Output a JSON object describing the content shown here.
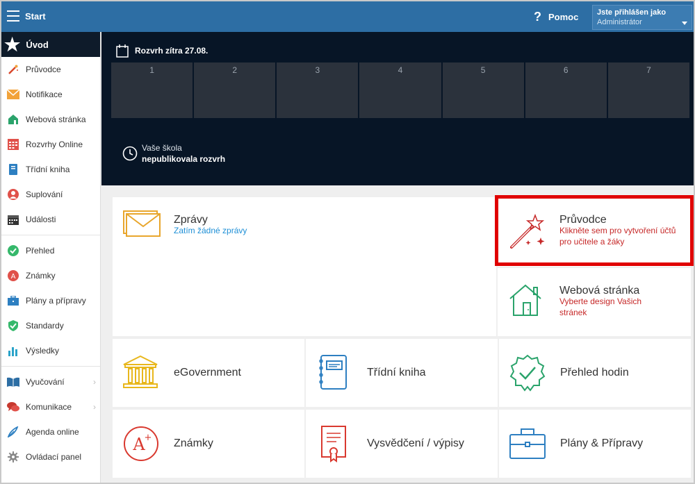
{
  "topbar": {
    "title": "Start",
    "help_label": "Pomoc",
    "user_line1": "Jste přihlášen jako",
    "user_line2": "Administrátor"
  },
  "sidebar": {
    "active": "Úvod",
    "group1": [
      "Průvodce",
      "Notifikace",
      "Webová stránka",
      "Rozvrhy Online",
      "Třídní kniha",
      "Suplování",
      "Události"
    ],
    "group2": [
      "Přehled",
      "Známky",
      "Plány a přípravy",
      "Standardy",
      "Výsledky"
    ],
    "group3": [
      "Vyučování",
      "Komunikace",
      "Agenda online",
      "Ovládací panel"
    ]
  },
  "schedule": {
    "title": "Rozvrh zítra 27.08.",
    "periods": [
      "1",
      "2",
      "3",
      "4",
      "5",
      "6",
      "7"
    ],
    "school_line1": "Vaše škola",
    "school_line2": "nepublikovala rozvrh"
  },
  "tiles": {
    "messages": {
      "title": "Zprávy",
      "subtitle": "Zatím žádné zprávy"
    },
    "wizard": {
      "title": "Průvodce",
      "subtitle": "Klikněte sem pro vytvoření účtů pro učitele a žáky"
    },
    "website": {
      "title": "Webová stránka",
      "subtitle": "Vyberte design Vašich stránek"
    },
    "egov": {
      "title": "eGovernment"
    },
    "classbook": {
      "title": "Třídní kniha"
    },
    "hours": {
      "title": "Přehled hodin"
    },
    "grades": {
      "title": "Známky"
    },
    "report": {
      "title": "Vysvědčení / výpisy"
    },
    "plans": {
      "title": "Plány & Přípravy"
    }
  },
  "colors": {
    "topbar": "#2d6ea4",
    "dark": "#071526",
    "highlight": "#e00000",
    "link_blue": "#1e8fd6",
    "link_red": "#c62828"
  }
}
